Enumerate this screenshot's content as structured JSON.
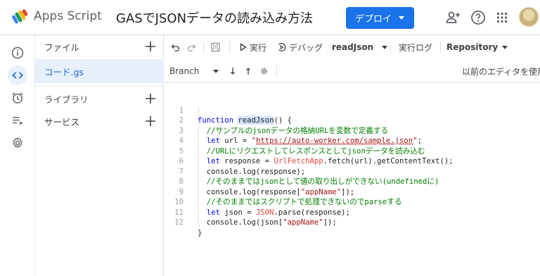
{
  "header": {
    "app_name": "Apps Script",
    "doc_title": "GASでJSONデータの読み込み方法",
    "deploy_label": "デプロイ",
    "icons": [
      "add-person-icon",
      "help-icon",
      "apps-grid-icon",
      "avatar"
    ]
  },
  "rail": {
    "icons": [
      "info-icon",
      "code-icon",
      "alarm-icon",
      "executions-icon",
      "settings-icon"
    ],
    "active": "code-icon"
  },
  "panel": {
    "files_label": "ファイル",
    "file_name": "コード.gs",
    "libraries_label": "ライブラリ",
    "services_label": "サービス"
  },
  "toolbar": {
    "run_label": "実行",
    "debug_label": "デバッグ",
    "function_name": "readJson",
    "log_label": "実行ログ",
    "repository_label": "Repository",
    "branch_label": "Branch",
    "legacy_editor_label": "以前のエディタを使用"
  },
  "editor": {
    "lines": [
      {
        "n": "1"
      },
      {
        "n": "2"
      },
      {
        "n": "3"
      },
      {
        "n": "4"
      },
      {
        "n": "5"
      },
      {
        "n": "6"
      },
      {
        "n": "7"
      },
      {
        "n": "8"
      },
      {
        "n": "9"
      },
      {
        "n": "10"
      },
      {
        "n": "11"
      },
      {
        "n": "12"
      }
    ],
    "tokens": {
      "l1_kw": "function",
      "l1_fn": "readJson",
      "l1_rest": "() {",
      "l2_cm": "//サンプルのjsonデータの格納URLを変数で定義する",
      "l3_kw": "let",
      "l3_mid": " url = ",
      "l3_q1": "\"",
      "l3_url": "https://auto-worker.com/sample.json",
      "l3_q2": "\"",
      "l3_end": ";",
      "l4_cm": "//URLにリクエストしてレスポンスとしてjsonデータを読み込む",
      "l5_kw": "let",
      "l5_mid": " response = ",
      "l5_cls": "UrlFetchApp",
      "l5_end": ".fetch(url).getContentText();",
      "l6": "console.log(response);",
      "l7_cm": "//そのままではjsonとして値の取り出しができない(undefinedに)",
      "l8_a": "console.log(response[",
      "l8_str": "\"appName\"",
      "l8_b": "]);",
      "l9_cm": "//そのままではスクリプトで処理できないのでparseする",
      "l10_kw": "let",
      "l10_mid": " json = ",
      "l10_cls": "JSON",
      "l10_end": ".parse(response);",
      "l11_a": "console.log(json[",
      "l11_str": "\"appName\"",
      "l11_b": "]);",
      "l12": "}"
    }
  }
}
